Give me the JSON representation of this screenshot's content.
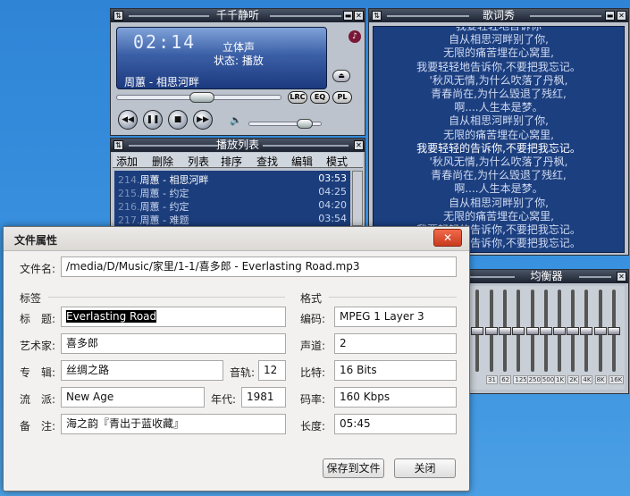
{
  "player": {
    "title": "千千静听",
    "time": "02:14",
    "mode": "立体声",
    "status": "状态: 播放",
    "track": "周蕙 - 相思河畔",
    "buttons": {
      "lrc": "LRC",
      "eq": "EQ",
      "pl": "PL"
    },
    "seek_progress": 0.52,
    "volume": 0.85
  },
  "playlist": {
    "title": "播放列表",
    "menu": [
      "添加",
      "删除",
      "列表",
      "排序",
      "查找",
      "编辑",
      "模式"
    ],
    "rows": [
      {
        "num": "214.",
        "name": "周蕙 - 相思河畔",
        "dur": "03:53"
      },
      {
        "num": "215.",
        "name": "周蕙 - 约定",
        "dur": "04:25"
      },
      {
        "num": "216.",
        "name": "周蕙 - 约定",
        "dur": "04:20"
      },
      {
        "num": "217.",
        "name": "周蕙 - 难题",
        "dur": "03:54"
      }
    ]
  },
  "lyrics": {
    "title": "歌词秀",
    "lines": [
      "我要轻轻地告诉你",
      "自从相思河畔别了你,",
      "无限的痛苦埋在心窝里,",
      "我要轻轻地告诉你,不要把我忘记。",
      "'秋风无情,为什么吹落了丹枫,",
      "青春尚在,为什么毁退了残红,",
      "啊....人生本是梦。",
      "自从相思河畔别了你,",
      "无限的痛苦埋在心窝里,",
      "我要轻轻的告诉你,不要把我忘记。",
      "'秋风无情,为什么吹落了丹枫,",
      "青春尚在,为什么毁退了残红,",
      "啊....人生本是梦。",
      "自从相思河畔别了你,",
      "无限的痛苦埋在心窝里,",
      "我要轻轻的告诉你,不要把我忘记。",
      "我要轻轻的告诉你,不要把我忘记。"
    ],
    "highlight_index": 9
  },
  "equalizer": {
    "title": "均衡器",
    "bands": [
      "31",
      "62",
      "125",
      "250",
      "500",
      "1K",
      "2K",
      "4K",
      "8K",
      "16K"
    ],
    "levels": [
      0.5,
      0.5,
      0.5,
      0.5,
      0.5,
      0.5,
      0.5,
      0.5,
      0.5,
      0.5
    ],
    "preamp_level": 0.5
  },
  "dialog": {
    "title": "文件属性",
    "close_glyph": "✕",
    "filename_label": "文件名:",
    "filename_value": "/media/D/Music/家里/1-1/喜多郎 - Everlasting Road.mp3",
    "tags_section": "标签",
    "format_section": "格式",
    "title_label": "标　题:",
    "title_value": "Everlasting Road",
    "artist_label": "艺术家:",
    "artist_value": "喜多郎",
    "album_label": "专　辑:",
    "album_value": "丝绸之路",
    "track_label": "音轨:",
    "track_value": "12",
    "genre_label": "流　派:",
    "genre_value": "New Age",
    "year_label": "年代:",
    "year_value": "1981",
    "comment_label": "备　注:",
    "comment_value": "海之韵『青出于蓝收藏』",
    "encoding_label": "编码:",
    "encoding_value": "MPEG 1 Layer 3",
    "channels_label": "声道:",
    "channels_value": "2",
    "bits_label": "比特:",
    "bits_value": "16 Bits",
    "bitrate_label": "码率:",
    "bitrate_value": "160 Kbps",
    "length_label": "长度:",
    "length_value": "05:45",
    "save_button": "保存到文件",
    "close_button": "关闭"
  }
}
